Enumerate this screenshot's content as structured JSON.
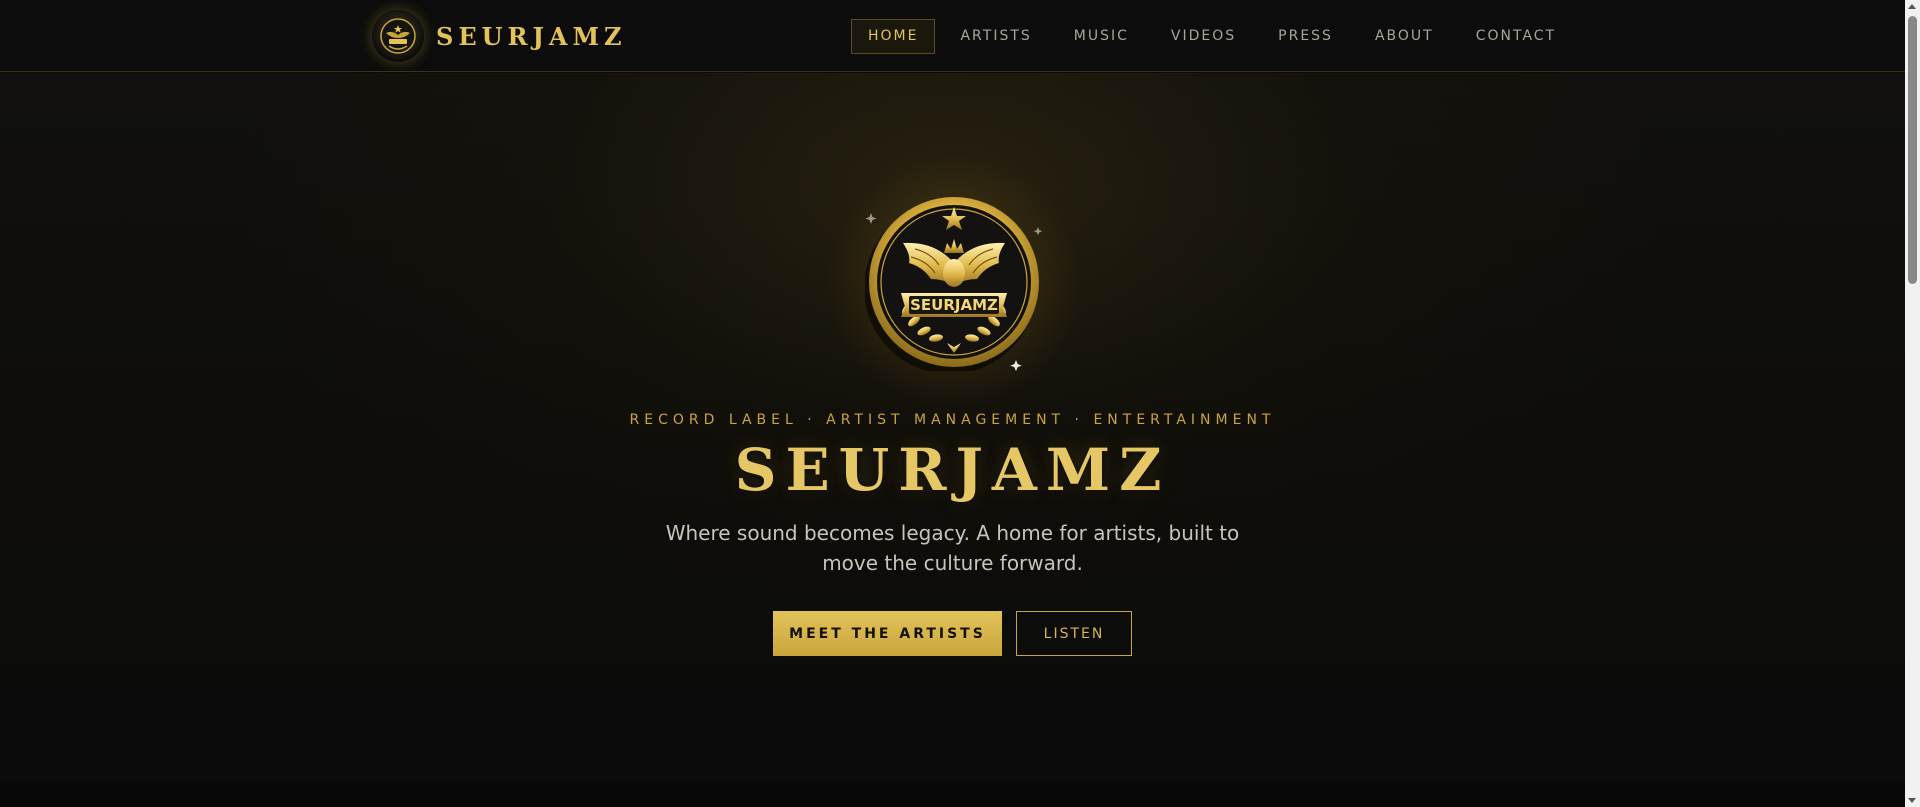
{
  "brand": {
    "name": "SEURJAMZ",
    "logo_icon": "eagle-crest-emblem",
    "accent_color": "#e3c25a"
  },
  "nav": {
    "items": [
      {
        "label": "HOME",
        "active": true
      },
      {
        "label": "ARTISTS",
        "active": false
      },
      {
        "label": "MUSIC",
        "active": false
      },
      {
        "label": "VIDEOS",
        "active": false
      },
      {
        "label": "PRESS",
        "active": false
      },
      {
        "label": "ABOUT",
        "active": false
      },
      {
        "label": "CONTACT",
        "active": false
      }
    ]
  },
  "hero": {
    "emblem_text": "SEURJAMZ",
    "tagline": "RECORD LABEL · ARTIST MANAGEMENT · ENTERTAINMENT",
    "title": "SEURJAMZ",
    "subtitle": "Where sound becomes legacy. A home for artists, built to move the culture forward.",
    "primary_cta": "MEET THE ARTISTS",
    "secondary_cta": "LISTEN"
  },
  "colors": {
    "background": "#0b0b0b",
    "gold": "#d4af37",
    "text_muted": "#a9a498"
  }
}
